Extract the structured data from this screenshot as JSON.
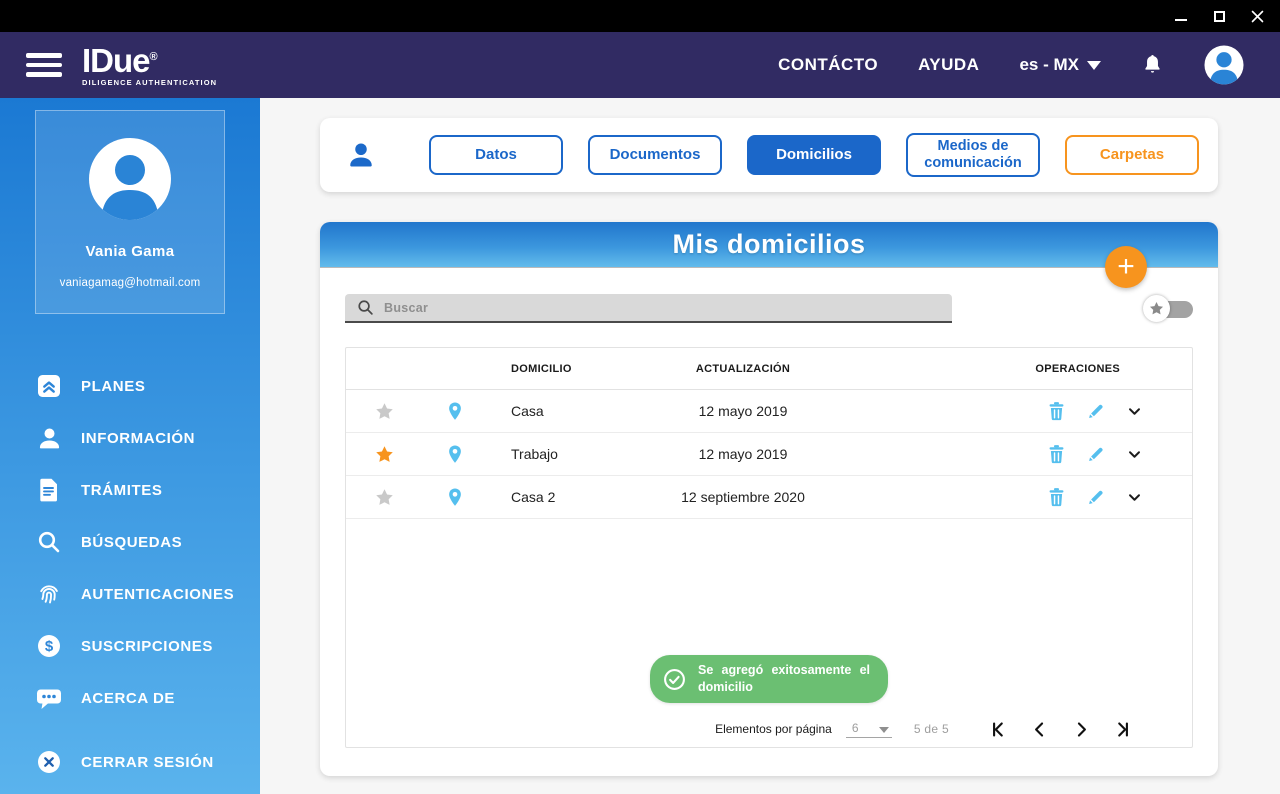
{
  "colors": {
    "navy": "#312b63",
    "accent_blue": "#1b67c9",
    "light_blue": "#55bfee",
    "orange": "#f7941e",
    "toast_green": "#6bbf72",
    "sidebar_top": "#1b79d3",
    "sidebar_bottom": "#5ab3ed"
  },
  "window": {
    "icons": [
      "minimize-icon",
      "maximize-icon",
      "close-icon"
    ]
  },
  "header": {
    "brand": {
      "name": "IDue",
      "registered": "®",
      "tagline": "DILIGENCE AUTHENTICATION"
    },
    "nav": [
      {
        "label": "CONTÁCTO"
      },
      {
        "label": "AYUDA"
      }
    ],
    "language": "es - MX",
    "icons": [
      "menu-icon",
      "bell-icon",
      "user-avatar"
    ]
  },
  "sidebar": {
    "user": {
      "name": "Vania Gama",
      "email": "vaniagamag@hotmail.com"
    },
    "items": [
      {
        "icon": "plans-icon",
        "label": "PLANES"
      },
      {
        "icon": "person-icon",
        "label": "INFORMACIÓN"
      },
      {
        "icon": "document-icon",
        "label": "TRÁMITES"
      },
      {
        "icon": "search-icon",
        "label": "BÚSQUEDAS"
      },
      {
        "icon": "fingerprint-icon",
        "label": "AUTENTICACIONES"
      },
      {
        "icon": "dollar-icon",
        "label": "SUSCRIPCIONES"
      },
      {
        "icon": "chat-icon",
        "label": "ACERCA DE"
      }
    ],
    "logout": {
      "icon": "logout-icon",
      "label": "CERRAR SESIÓN"
    }
  },
  "tabs": [
    {
      "label": "Datos",
      "active": false,
      "style": "blue"
    },
    {
      "label": "Documentos",
      "active": false,
      "style": "blue"
    },
    {
      "label": "Domicilios",
      "active": true,
      "style": "blue"
    },
    {
      "label": "Medios de comunicación",
      "active": false,
      "style": "blue"
    },
    {
      "label": "Carpetas",
      "active": false,
      "style": "orange"
    }
  ],
  "panel": {
    "title": "Mis domicilios",
    "add_button": "+",
    "search": {
      "placeholder": "Buscar"
    },
    "favorites_toggle": {
      "icon": "star-icon",
      "state": "off"
    },
    "table": {
      "headers": {
        "domicilio": "DOMICILIO",
        "actualizacion": "ACTUALIZACIÓN",
        "operaciones": "OPERACIONES"
      },
      "rows": [
        {
          "favorite": false,
          "name": "Casa",
          "updated": "12 mayo 2019"
        },
        {
          "favorite": true,
          "name": "Trabajo",
          "updated": "12 mayo 2019"
        },
        {
          "favorite": false,
          "name": "Casa 2",
          "updated": "12 septiembre 2020"
        }
      ]
    },
    "toast": {
      "icon": "check-circle-icon",
      "message": "Se agregó exitosamente el domicilio"
    },
    "pagination": {
      "items_per_page_label": "Elementos por página",
      "per_page": "6",
      "range": "5 de 5"
    }
  }
}
